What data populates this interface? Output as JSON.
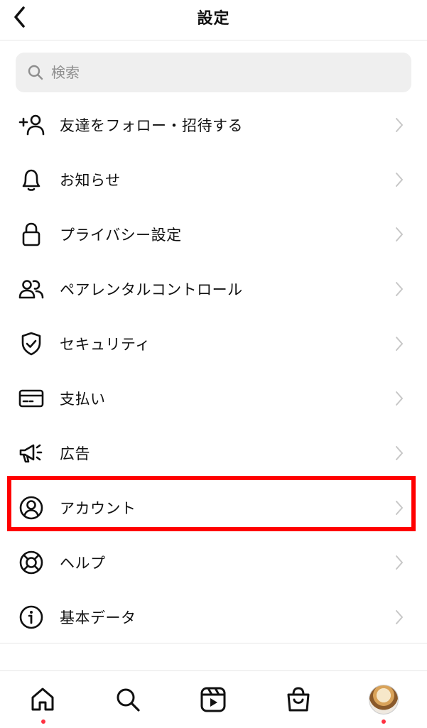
{
  "header": {
    "title": "設定"
  },
  "search": {
    "placeholder": "検索"
  },
  "menu": {
    "items": [
      {
        "label": "友達をフォロー・招待する",
        "icon": "add-person-icon"
      },
      {
        "label": "お知らせ",
        "icon": "bell-icon"
      },
      {
        "label": "プライバシー設定",
        "icon": "lock-icon"
      },
      {
        "label": "ペアレンタルコントロール",
        "icon": "people-icon"
      },
      {
        "label": "セキュリティ",
        "icon": "shield-check-icon"
      },
      {
        "label": "支払い",
        "icon": "credit-card-icon"
      },
      {
        "label": "広告",
        "icon": "megaphone-icon"
      },
      {
        "label": "アカウント",
        "icon": "account-circle-icon",
        "highlighted": true
      },
      {
        "label": "ヘルプ",
        "icon": "lifebuoy-icon"
      },
      {
        "label": "基本データ",
        "icon": "info-icon"
      }
    ]
  },
  "tabbar": {
    "tabs": [
      "home-icon",
      "search-icon",
      "reels-icon",
      "shop-icon",
      "profile-avatar"
    ],
    "notification_color": "#ff3040"
  },
  "colors": {
    "highlight": "#ff0000",
    "chevron": "#c7c7c7"
  }
}
